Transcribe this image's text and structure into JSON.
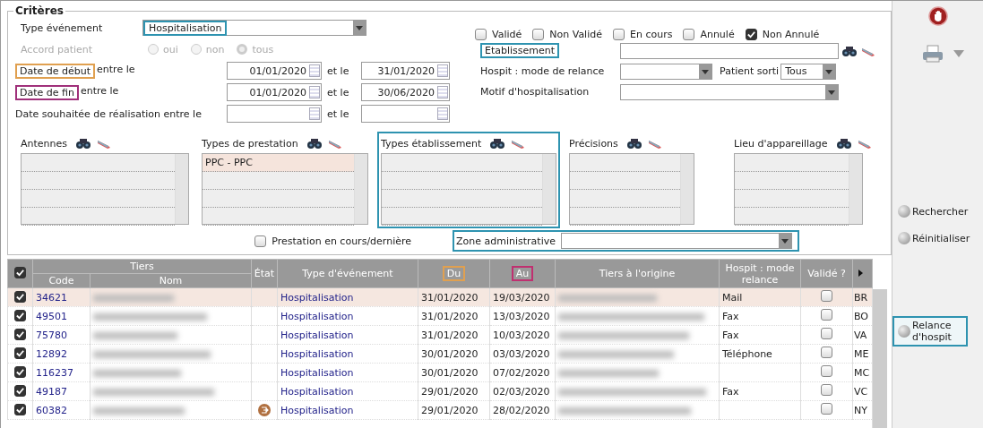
{
  "criteria": {
    "title": "Critères",
    "type_evenement": {
      "label": "Type événement",
      "value": "Hospitalisation",
      "color": "#2e93b0"
    },
    "accord_patient": {
      "label": "Accord patient",
      "disabled": true,
      "options": [
        {
          "label": "oui",
          "selected": false
        },
        {
          "label": "non",
          "selected": false
        },
        {
          "label": "tous",
          "selected": true
        }
      ]
    },
    "date_rows": [
      {
        "label": "Date de début",
        "color": "#e0a050",
        "suffix": "entre le",
        "from": "01/01/2020",
        "and": "et le",
        "to": "31/01/2020"
      },
      {
        "label": "Date de fin",
        "color": "#a0307a",
        "suffix": "entre le",
        "from": "01/01/2020",
        "and": "et le",
        "to": "30/06/2020"
      },
      {
        "label": "Date souhaitée de réalisation entre le",
        "and": "et le"
      }
    ],
    "status_checks": [
      {
        "label": "Validé",
        "checked": false
      },
      {
        "label": "Non Validé",
        "checked": false
      },
      {
        "label": "En cours",
        "checked": false
      },
      {
        "label": "Annulé",
        "checked": false
      },
      {
        "label": "Non Annulé",
        "checked": true
      }
    ],
    "etablissement": {
      "label": "Etablissement",
      "color": "#2e93b0"
    },
    "mode_relance": {
      "label": "Hospit : mode de relance"
    },
    "patient_sorti": {
      "label": "Patient sorti",
      "value": "Tous"
    },
    "motif": {
      "label": "Motif d'hospitalisation"
    },
    "lists": [
      {
        "title": "Antennes"
      },
      {
        "title": "Types de prestation",
        "items": [
          "PPC - PPC"
        ]
      },
      {
        "title": "Types établissement",
        "color": "#2e93b0"
      },
      {
        "title": "Précisions"
      },
      {
        "title": "Lieu d'appareillage"
      }
    ],
    "prestation_check": {
      "label": "Prestation en cours/dernière",
      "checked": false
    },
    "zone": {
      "label": "Zone administrative",
      "color": "#2e93b0"
    }
  },
  "side": {
    "buttons": [
      {
        "label": "Rechercher"
      },
      {
        "label": "Réinitialiser"
      },
      {
        "label": "Relance d'hospit",
        "color": "#2e93b0"
      }
    ]
  },
  "table": {
    "all_checked": true,
    "group_header": "Tiers",
    "columns": [
      {
        "label": "Code"
      },
      {
        "label": "Nom"
      },
      {
        "label": "État"
      },
      {
        "label": "Type d'événement"
      },
      {
        "label": "Du",
        "color": "#e0a050"
      },
      {
        "label": "Au",
        "color": "#c03070"
      },
      {
        "label": "Tiers à l'origine"
      },
      {
        "label": "Hospit : mode relance"
      },
      {
        "label": "Validé ?"
      }
    ],
    "rows": [
      {
        "checked": true,
        "selected": true,
        "code": "34621",
        "state_icon": false,
        "type": "Hospitalisation",
        "du": "31/01/2020",
        "au": "19/03/2020",
        "relance": "Mail",
        "valide": false,
        "column_11": "BR"
      },
      {
        "checked": true,
        "selected": false,
        "code": "49501",
        "state_icon": false,
        "type": "Hospitalisation",
        "du": "31/01/2020",
        "au": "13/03/2020",
        "relance": "Fax",
        "valide": false,
        "column_11": "BO"
      },
      {
        "checked": true,
        "selected": false,
        "code": "75780",
        "state_icon": false,
        "type": "Hospitalisation",
        "du": "31/01/2020",
        "au": "10/03/2020",
        "relance": "Fax",
        "valide": false,
        "column_11": "VA"
      },
      {
        "checked": true,
        "selected": false,
        "code": "12892",
        "state_icon": false,
        "type": "Hospitalisation",
        "du": "30/01/2020",
        "au": "03/03/2020",
        "relance": "Téléphone",
        "valide": false,
        "column_11": "ME"
      },
      {
        "checked": true,
        "selected": false,
        "code": "116237",
        "state_icon": false,
        "type": "Hospitalisation",
        "du": "30/01/2020",
        "au": "07/02/2020",
        "valide": false,
        "column_11": "MC"
      },
      {
        "checked": true,
        "selected": false,
        "code": "49187",
        "state_icon": false,
        "type": "Hospitalisation",
        "du": "29/01/2020",
        "au": "02/03/2020",
        "relance": "Fax",
        "valide": false,
        "column_11": "VC"
      },
      {
        "checked": true,
        "selected": false,
        "code": "60382",
        "state_icon": true,
        "type": "Hospitalisation",
        "du": "29/01/2020",
        "au": "28/02/2020",
        "valide": false,
        "column_11": "NY"
      }
    ]
  }
}
